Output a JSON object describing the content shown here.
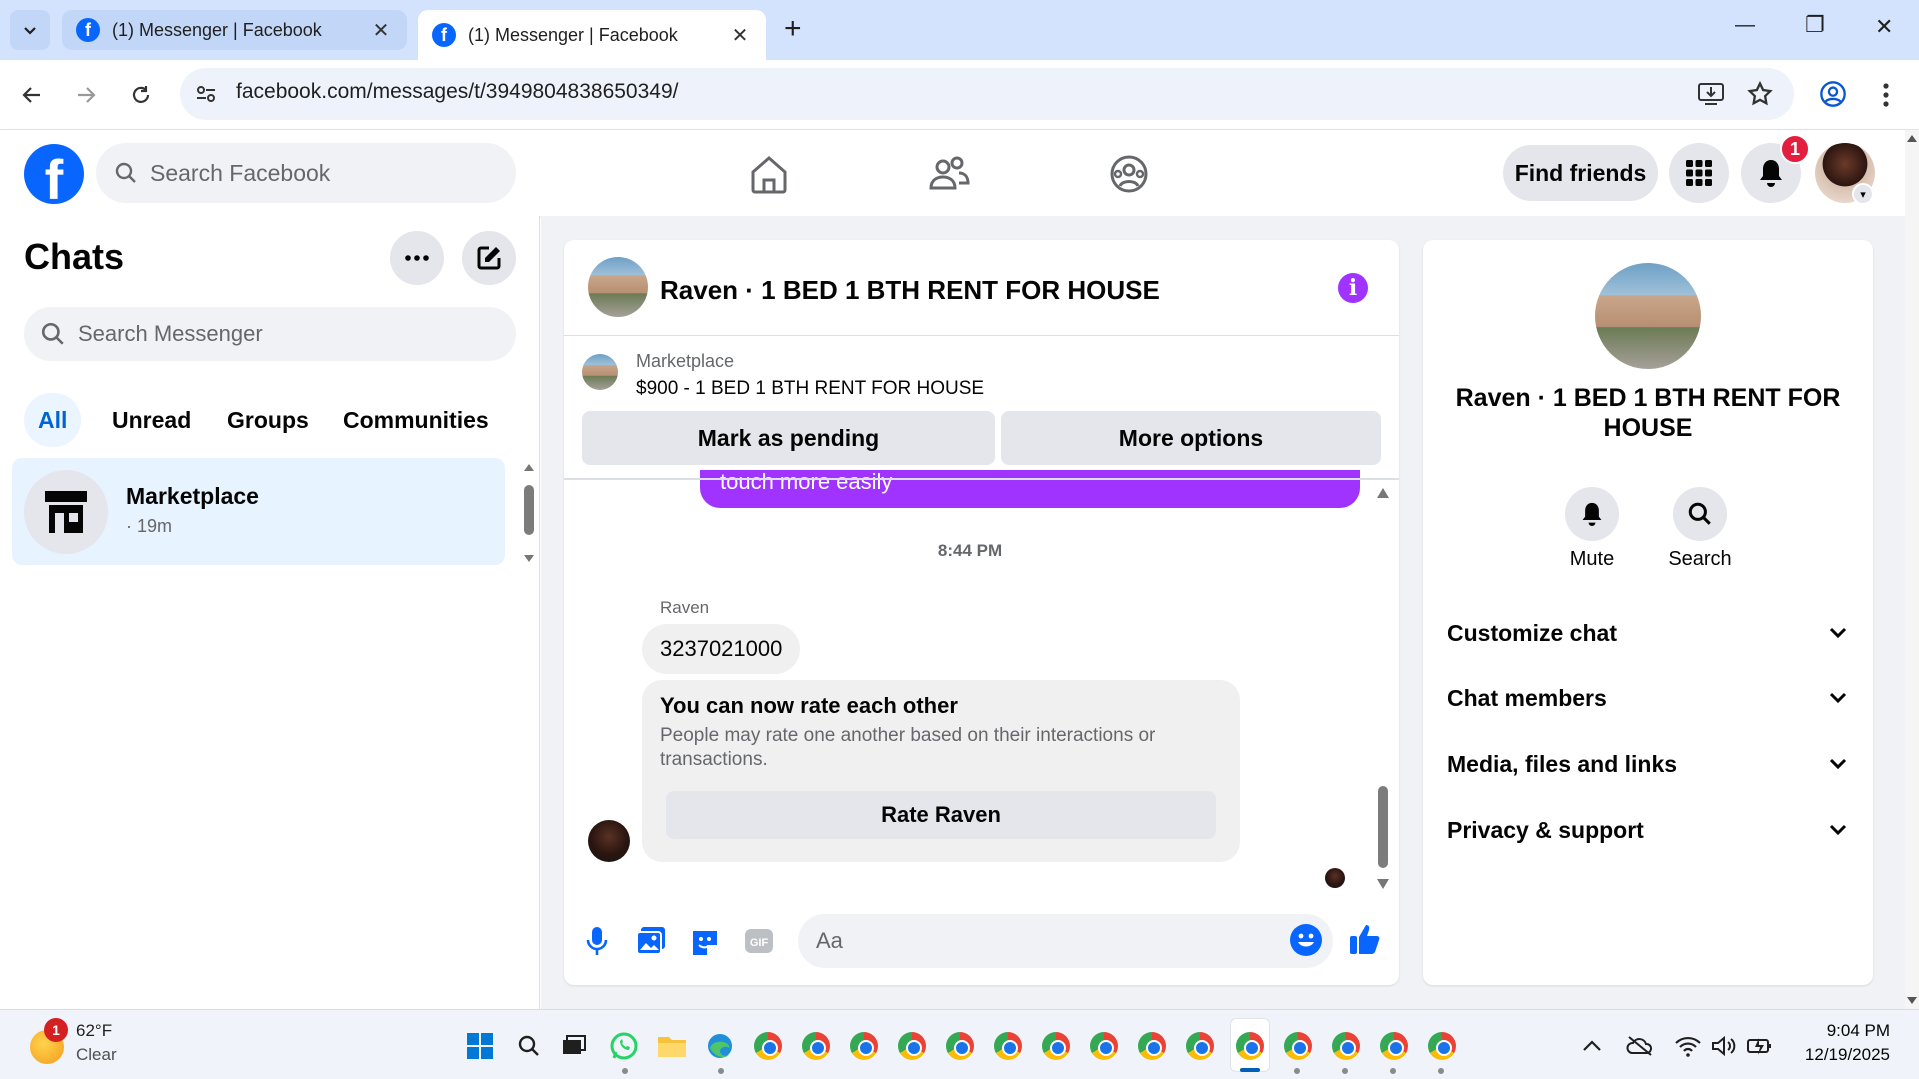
{
  "browser": {
    "tabs": [
      {
        "title": "(1) Messenger | Facebook",
        "close": "✕"
      },
      {
        "title": "(1) Messenger | Facebook",
        "close": "✕"
      }
    ],
    "new_tab": "+",
    "url": "facebook.com/messages/t/3949804838650349/",
    "window_controls": {
      "minimize": "—",
      "restore": "❐",
      "close": "✕"
    }
  },
  "fb_header": {
    "logo": "f",
    "search_placeholder": "Search Facebook",
    "find_friends_label": "Find friends",
    "notification_count": "1"
  },
  "chats_panel": {
    "title": "Chats",
    "search_placeholder": "Search Messenger",
    "filters": [
      "All",
      "Unread",
      "Groups",
      "Communities"
    ],
    "active_filter": "All",
    "items": [
      {
        "name": "Marketplace",
        "time": "· 19m"
      }
    ]
  },
  "conversation": {
    "title": "Raven · 1 BED 1 BTH RENT FOR HOUSE",
    "pinned": {
      "label": "Marketplace",
      "listing": "$900 - 1 BED 1 BTH RENT FOR HOUSE",
      "mark_pending_label": "Mark as pending",
      "more_options_label": "More options"
    },
    "partial_outgoing_message": "touch more easily",
    "timestamp": "8:44 PM",
    "sender_name": "Raven",
    "incoming_message": "3237021000",
    "rating_card": {
      "title": "You can now rate each other",
      "description": "People may rate one another based on their interactions or transactions.",
      "button_label": "Rate Raven"
    },
    "composer_placeholder": "Aa",
    "composer_icons": [
      "microphone-icon",
      "photo-icon",
      "sticker-icon",
      "gif-icon",
      "emoji-icon",
      "thumbs-up-icon"
    ]
  },
  "info_panel": {
    "title": "Raven · 1 BED 1 BTH RENT FOR HOUSE",
    "actions": [
      {
        "label": "Mute",
        "icon": "bell-icon"
      },
      {
        "label": "Search",
        "icon": "search-icon"
      }
    ],
    "sections": [
      "Customize chat",
      "Chat members",
      "Media, files and links",
      "Privacy & support"
    ]
  },
  "taskbar": {
    "weather_badge": "1",
    "temperature": "62°F",
    "condition": "Clear",
    "time": "9:04 PM",
    "date": "12/19/2025"
  },
  "colors": {
    "facebook_blue": "#0866ff",
    "messenger_purple": "#a033ff",
    "notification_red": "#e41e3f",
    "selected_chat_bg": "#e7f3ff"
  }
}
